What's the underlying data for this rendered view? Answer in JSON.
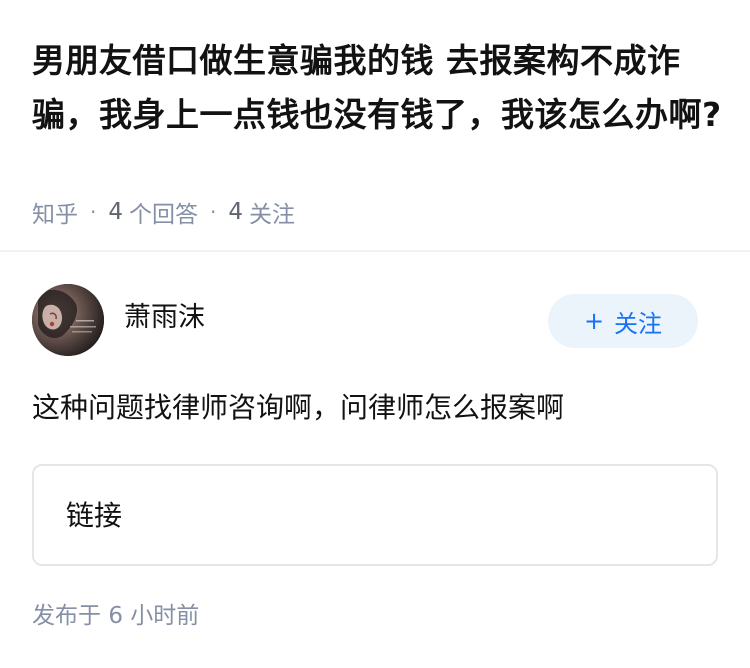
{
  "question": {
    "title": "男朋友借口做生意骗我的钱 去报案构不成诈骗，我身上一点钱也没有钱了，我该怎么办啊?",
    "source": "知乎",
    "answer_count": "4",
    "answer_label": "个回答",
    "follow_count": "4",
    "follow_label": "关注"
  },
  "answer": {
    "author_name": "萧雨沫",
    "follow_button": "关注",
    "content": "这种问题找律师咨询啊，问律师怎么报案啊",
    "link_label": "链接",
    "published_prefix": "发布于",
    "published_time": "6 小时前"
  },
  "colors": {
    "accent": "#1772f6",
    "follow_bg": "#ebf3fb",
    "meta_text": "#8590a6",
    "title_text": "#121212"
  },
  "icons": {
    "follow_plus": "plus-icon"
  }
}
